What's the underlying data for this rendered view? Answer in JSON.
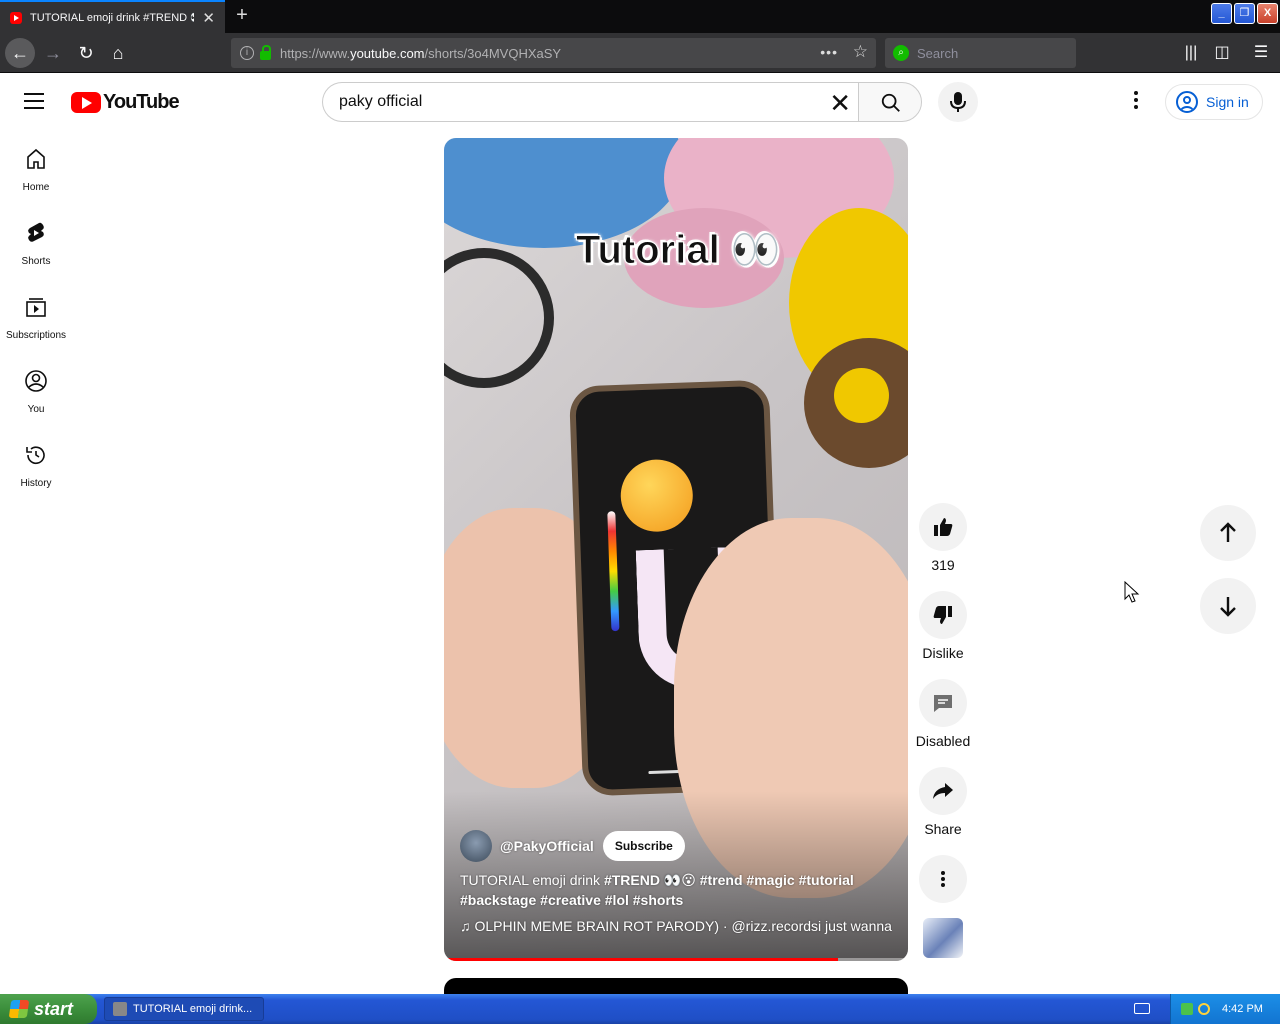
{
  "browser": {
    "tab_title": "TUTORIAL emoji drink #TREND 👀",
    "new_tab": "+",
    "url_prefix": "https://www.",
    "url_domain": "youtube.com",
    "url_path": "/shorts/3o4MVQHXaSY",
    "search_placeholder": "Search",
    "win_minimize": "_",
    "win_restore": "❐",
    "win_close": "X"
  },
  "youtube": {
    "logo_text": "YouTube",
    "search_value": "paky official",
    "sign_in_label": "Sign in",
    "guide": [
      {
        "label": "Home"
      },
      {
        "label": "Shorts"
      },
      {
        "label": "Subscriptions"
      },
      {
        "label": "You"
      },
      {
        "label": "History"
      }
    ]
  },
  "short": {
    "overlay_title": "Tutorial 👀",
    "channel": "@PakyOfficial",
    "subscribe_label": "Subscribe",
    "description_start": "TUTORIAL emoji drink ",
    "description_tags_1": "#TREND 👀😮 #trend #magic #tutorial",
    "description_tags_2": "#backstage #creative #lol #shorts",
    "music_note": "♫",
    "music_text": "OLPHIN MEME BRAIN ROT PARODY) · @rizz.records",
    "music_text_2": "i just wanna",
    "progress": 0.85,
    "like_count": "319",
    "dislike_label": "Dislike",
    "comments_label": "Disabled",
    "share_label": "Share"
  },
  "taskbar": {
    "start_label": "start",
    "task_item": "TUTORIAL emoji drink...",
    "clock": "4:42 PM"
  },
  "colors": {
    "accent_red": "#ff0000",
    "link_blue": "#065fd4"
  }
}
